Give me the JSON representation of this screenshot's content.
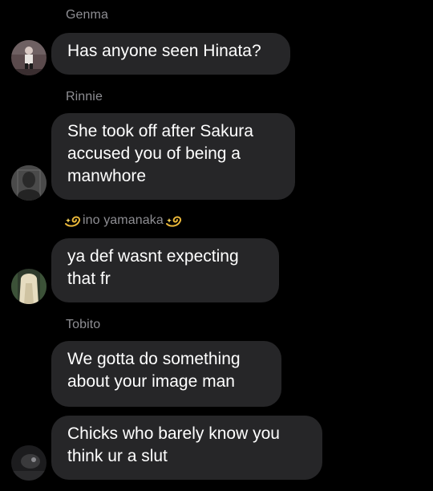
{
  "messages": [
    {
      "sender": "Genma",
      "lines": [
        "Has anyone seen Hinata?"
      ],
      "avatar_icon": "profile-photo-person-standing"
    },
    {
      "sender": "Rinnie",
      "lines": [
        "She took off after Sakura",
        "accused you of being a",
        "manwhore"
      ],
      "avatar_icon": "profile-photo-dark-portrait"
    },
    {
      "sender": "ino yamanaka",
      "sender_decoration_icon": "dizzy-star-emoji",
      "lines": [
        "ya def wasnt expecting",
        "that fr"
      ],
      "avatar_icon": "profile-photo-blonde-hair"
    },
    {
      "sender": "Tobito",
      "lines": [
        "We gotta do something",
        "about your image man"
      ]
    },
    {
      "lines": [
        "Chicks who barely know you",
        "think ur a slut"
      ],
      "avatar_icon": "profile-photo-dark-scene"
    }
  ],
  "colors": {
    "background": "#000000",
    "bubble": "#262628",
    "sender_name": "#8e8e93",
    "message_text": "#ffffff"
  }
}
